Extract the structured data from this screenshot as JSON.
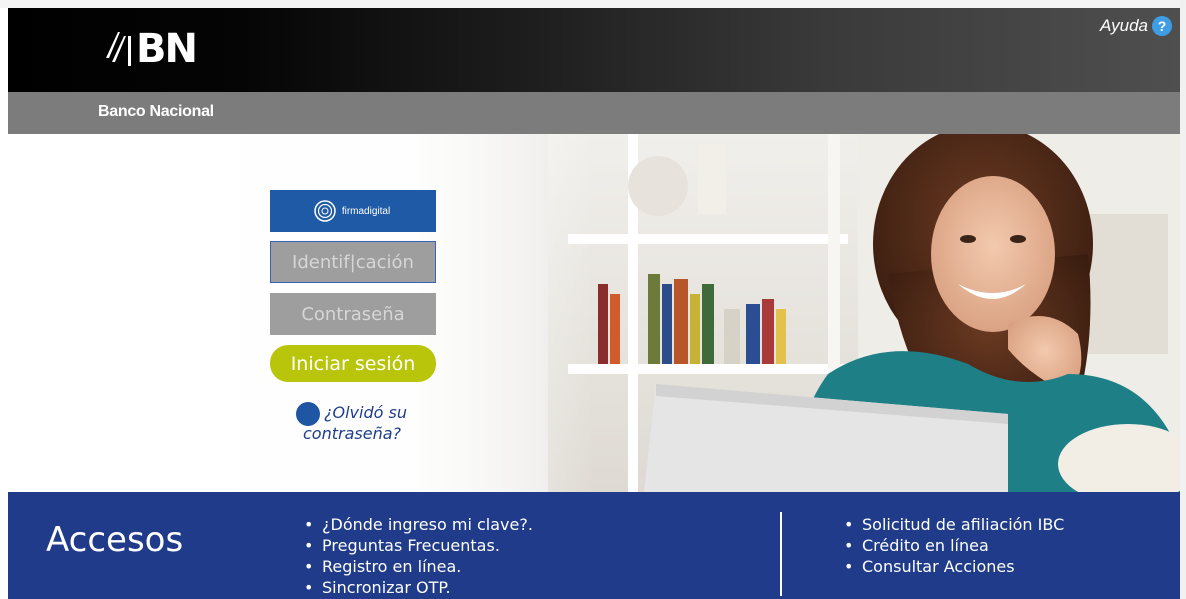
{
  "header": {
    "logo_text": "BN",
    "help_label": "Ayuda",
    "help_icon": "question-icon"
  },
  "subheader": {
    "bank_name": "Banco Nacional"
  },
  "login": {
    "firma_digital_label": "firmadigital",
    "identification_placeholder": "Identif|cación",
    "password_placeholder": "Contraseña",
    "login_button": "Iniciar sesión",
    "forgot_line1": "¿Olvidó su",
    "forgot_line2": "contraseña?"
  },
  "footer": {
    "title": "Accesos",
    "left_links": [
      "¿Dónde ingreso mi clave?.",
      "Preguntas Frecuentas.",
      "Registro en línea.",
      "Sincronizar OTP."
    ],
    "right_links": [
      "Solicitud de afiliación IBC",
      "Crédito en línea",
      "Consultar Acciones"
    ]
  },
  "colors": {
    "header_dark": "#000000",
    "subheader_gray": "#7c7c7c",
    "footer_blue": "#1f3b8a",
    "login_green": "#b9c50b",
    "firma_blue": "#1f5aa6"
  }
}
